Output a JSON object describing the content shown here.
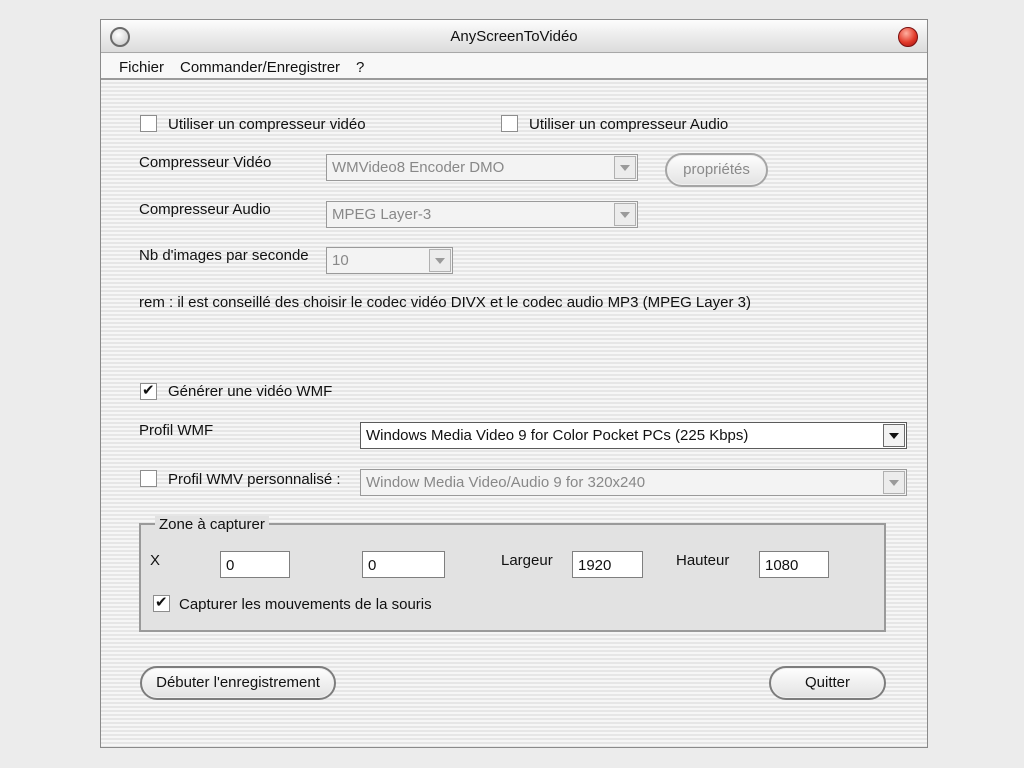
{
  "window": {
    "title": "AnyScreenToVidéo"
  },
  "menu": {
    "fichier": "Fichier",
    "commander": "Commander/Enregistrer",
    "help": "?"
  },
  "options": {
    "use_video_compressor": {
      "label": "Utiliser un compresseur vidéo",
      "checked": false
    },
    "use_audio_compressor": {
      "label": "Utiliser un compresseur Audio",
      "checked": false
    }
  },
  "video_compressor": {
    "label": "Compresseur Vidéo",
    "value": "WMVideo8 Encoder DMO",
    "properties_button": "propriétés"
  },
  "audio_compressor": {
    "label": "Compresseur Audio",
    "value": "MPEG Layer-3"
  },
  "fps": {
    "label": "Nb d'images par seconde",
    "value": "10"
  },
  "remark": "rem : il est conseillé des choisir le codec vidéo DIVX et le codec audio MP3 (MPEG Layer 3)",
  "wmf": {
    "generate_label": "Générer une vidéo WMF",
    "generate_checked": true,
    "profile_label": "Profil WMF",
    "profile_value": "Windows Media Video 9 for Color Pocket PCs (225 Kbps)",
    "custom_label": "Profil WMV personnalisé :",
    "custom_checked": false,
    "custom_value": "Window Media Video/Audio 9 for 320x240"
  },
  "capture_zone": {
    "title": "Zone à capturer",
    "x_label": "X",
    "x_value": "0",
    "y_value": "0",
    "width_label": "Largeur",
    "width_value": "1920",
    "height_label": "Hauteur",
    "height_value": "1080",
    "mouse_label": "Capturer les mouvements de la souris",
    "mouse_checked": true
  },
  "buttons": {
    "start": "Débuter l'enregistrement",
    "quit": "Quitter"
  },
  "colors": {
    "close_button": "#e23a2a"
  }
}
